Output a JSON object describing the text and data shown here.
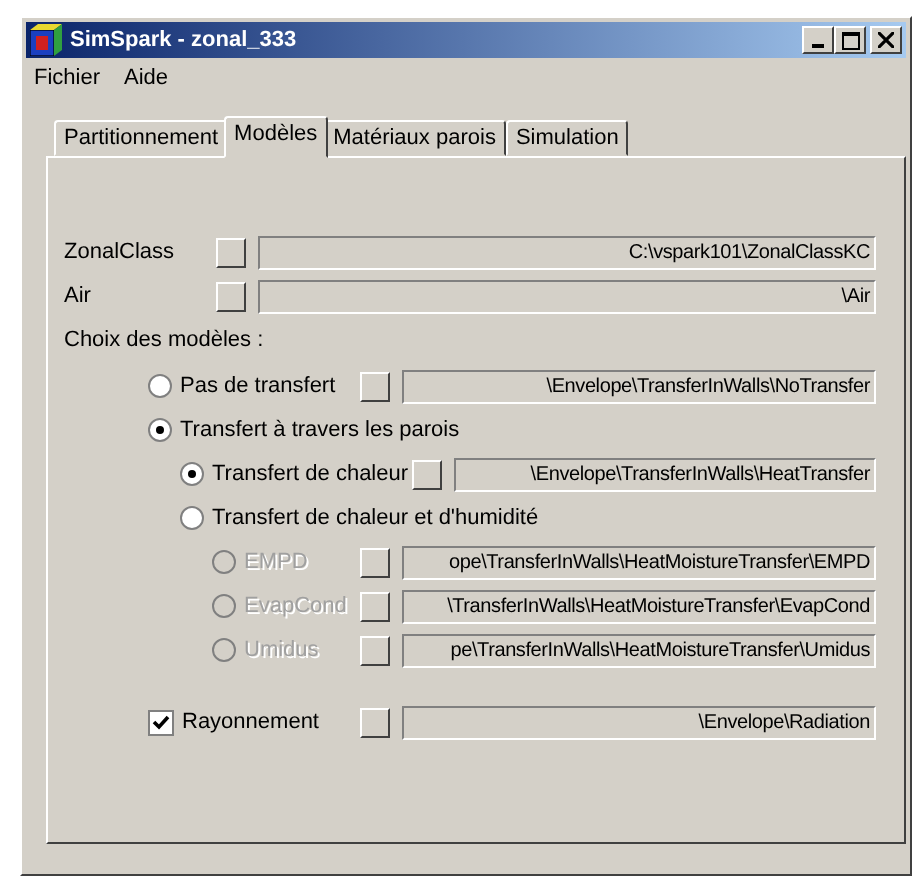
{
  "window": {
    "title": "SimSpark - zonal_333"
  },
  "menu": [
    "Fichier",
    "Aide"
  ],
  "tabs": [
    {
      "label": "Partitionnement",
      "selected": false
    },
    {
      "label": "Modèles",
      "selected": true
    },
    {
      "label": "Matériaux parois",
      "selected": false
    },
    {
      "label": "Simulation",
      "selected": false
    }
  ],
  "paths": [
    {
      "label": "ZonalClass",
      "value": "C:\\vspark101\\ZonalClassKC"
    },
    {
      "label": "Air",
      "value": "\\Air"
    }
  ],
  "choice_heading": "Choix des modèles :",
  "options": [
    {
      "label": "Pas de transfert",
      "selected": false,
      "disabled": false,
      "value": "\\Envelope\\TransferInWalls\\NoTransfer"
    },
    {
      "label": "Transfert à travers les parois",
      "selected": true,
      "disabled": false,
      "children": [
        {
          "label": "Transfert de chaleur",
          "selected": true,
          "disabled": false,
          "value": "\\Envelope\\TransferInWalls\\HeatTransfer"
        },
        {
          "label": "Transfert de chaleur et d'humidité",
          "selected": false,
          "disabled": false,
          "children": [
            {
              "label": "EMPD",
              "selected": false,
              "disabled": true,
              "value": "ope\\TransferInWalls\\HeatMoistureTransfer\\EMPD"
            },
            {
              "label": "EvapCond",
              "selected": false,
              "disabled": true,
              "value": "\\TransferInWalls\\HeatMoistureTransfer\\EvapCond"
            },
            {
              "label": "Umidus",
              "selected": false,
              "disabled": true,
              "value": "pe\\TransferInWalls\\HeatMoistureTransfer\\Umidus"
            }
          ]
        }
      ]
    }
  ],
  "radiation": {
    "label": "Rayonnement",
    "checked": true,
    "value": "\\Envelope\\Radiation"
  }
}
